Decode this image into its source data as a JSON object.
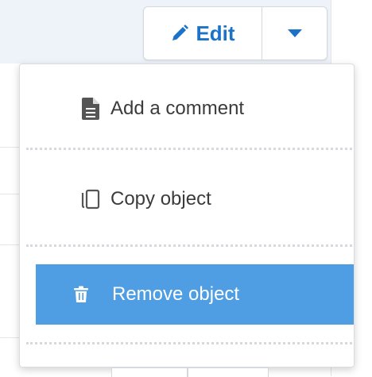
{
  "toolbar": {
    "edit_label": "Edit",
    "edit_icon": "pencil-icon",
    "dropdown_icon": "caret-down-icon"
  },
  "menu": {
    "items": [
      {
        "label": "Add a comment",
        "icon": "document-icon"
      },
      {
        "label": "Copy object",
        "icon": "copy-icon"
      },
      {
        "label": "Remove object",
        "icon": "trash-icon",
        "state": "highlighted"
      }
    ]
  },
  "colors": {
    "accent": "#1a73c9",
    "highlight": "#4f9de3",
    "header_background": "#eef3fa"
  }
}
